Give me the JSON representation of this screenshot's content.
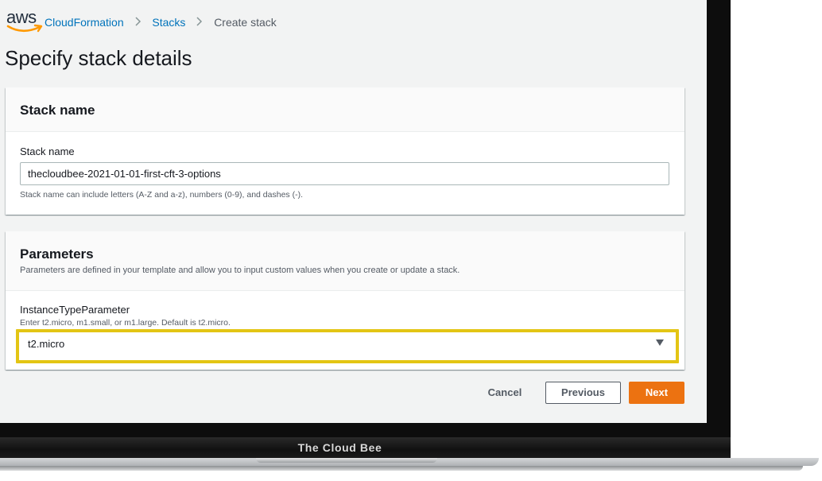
{
  "header": {
    "logo_text": "aws",
    "breadcrumb": {
      "service": "CloudFormation",
      "stacks": "Stacks",
      "current": "Create stack",
      "separator": ">"
    }
  },
  "page": {
    "title": "Specify stack details"
  },
  "stack_name_section": {
    "title": "Stack name",
    "field_label": "Stack name",
    "value": "thecloudbee-2021-01-01-first-cft-3-options",
    "hint": "Stack name can include letters (A-Z and a-z), numbers (0-9), and dashes (-)."
  },
  "parameters_section": {
    "title": "Parameters",
    "description": "Parameters are defined in your template and allow you to input custom values when you create or update a stack.",
    "field_label": "InstanceTypeParameter",
    "hint": "Enter t2.micro, m1.small, or m1.large. Default is t2.micro.",
    "selected_value": "t2.micro",
    "highlight_color": "#e3c514"
  },
  "actions": {
    "cancel": "Cancel",
    "previous": "Previous",
    "next": "Next",
    "primary_color": "#ec7211"
  },
  "device": {
    "brand_label": "The Cloud Bee"
  }
}
